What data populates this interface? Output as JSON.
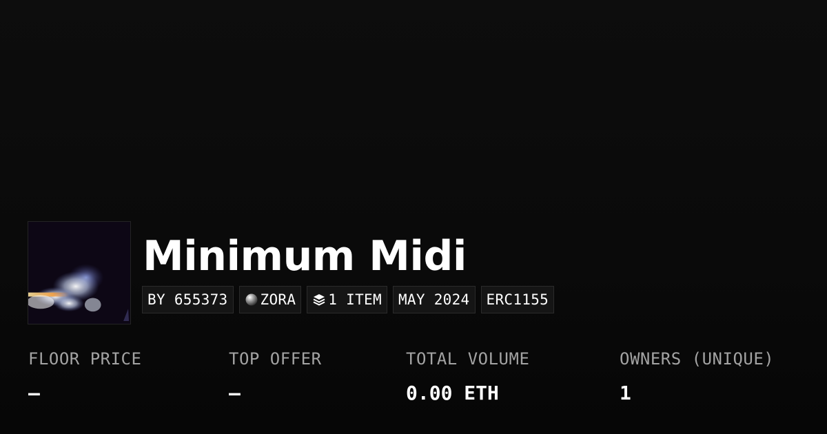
{
  "collection": {
    "title": "Minimum Midi",
    "thumbnail_icon": "smoke-artwork-image"
  },
  "tags": [
    {
      "label": "BY 655373",
      "icon": null
    },
    {
      "label": "ZORA",
      "icon": "zora-orb-icon"
    },
    {
      "label": "1 ITEM",
      "icon": "layers-icon"
    },
    {
      "label": "MAY 2024",
      "icon": null
    },
    {
      "label": "ERC1155",
      "icon": null
    }
  ],
  "stats": [
    {
      "label": "FLOOR PRICE",
      "value": "–"
    },
    {
      "label": "TOP OFFER",
      "value": "–"
    },
    {
      "label": "TOTAL VOLUME",
      "value": "0.00 ETH"
    },
    {
      "label": "OWNERS (UNIQUE)",
      "value": "1"
    }
  ],
  "colors": {
    "background": "#0b0b0b",
    "tag_background": "#151515",
    "tag_border": "#2b2b2b",
    "label_gray": "#a3a3a3",
    "text": "#ffffff"
  }
}
